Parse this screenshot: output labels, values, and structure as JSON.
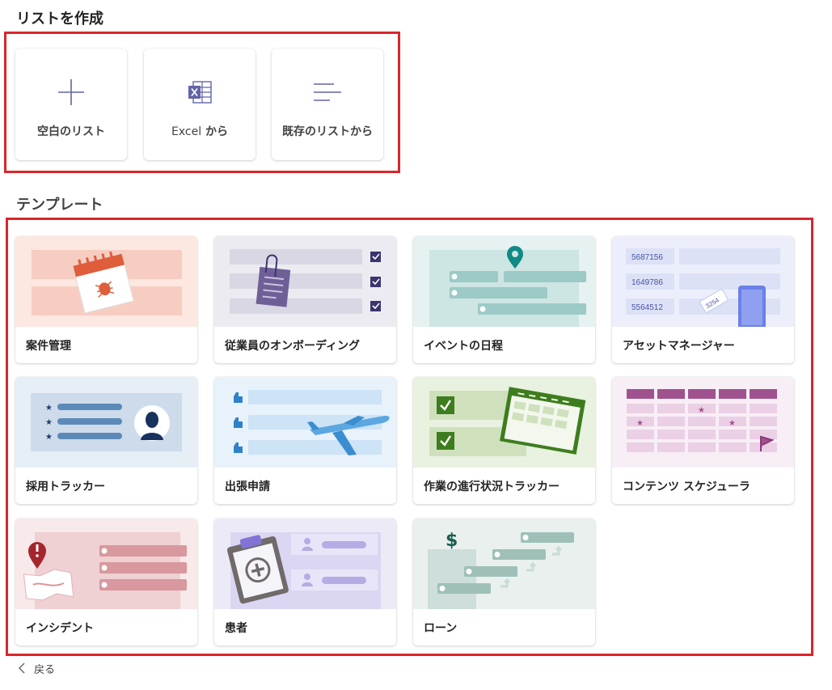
{
  "sections": {
    "create_title": "リストを作成",
    "templates_title": "テンプレート"
  },
  "create_options": [
    {
      "label": "空白のリスト",
      "icon": "plus-icon"
    },
    {
      "label_prefix": "Excel",
      "label_suffix": " から",
      "icon": "excel-icon"
    },
    {
      "label": "既存のリストから",
      "icon": "existing-list-icon"
    }
  ],
  "templates": [
    {
      "label": "案件管理"
    },
    {
      "label": "従業員のオンボーディング"
    },
    {
      "label": "イベントの日程"
    },
    {
      "label": "アセットマネージャー",
      "asset_ids": [
        "5687156",
        "1649786",
        "5564512"
      ],
      "tag": "3254"
    },
    {
      "label": "採用トラッカー"
    },
    {
      "label": "出張申請"
    },
    {
      "label": "作業の進行状況トラッカー"
    },
    {
      "label": "コンテンツ スケジューラ"
    },
    {
      "label": "インシデント"
    },
    {
      "label": "患者"
    },
    {
      "label": "ローン"
    }
  ],
  "back_label": "戻る",
  "colors": {
    "highlight": "#d9262c",
    "brand_purple": "#6264a7"
  }
}
